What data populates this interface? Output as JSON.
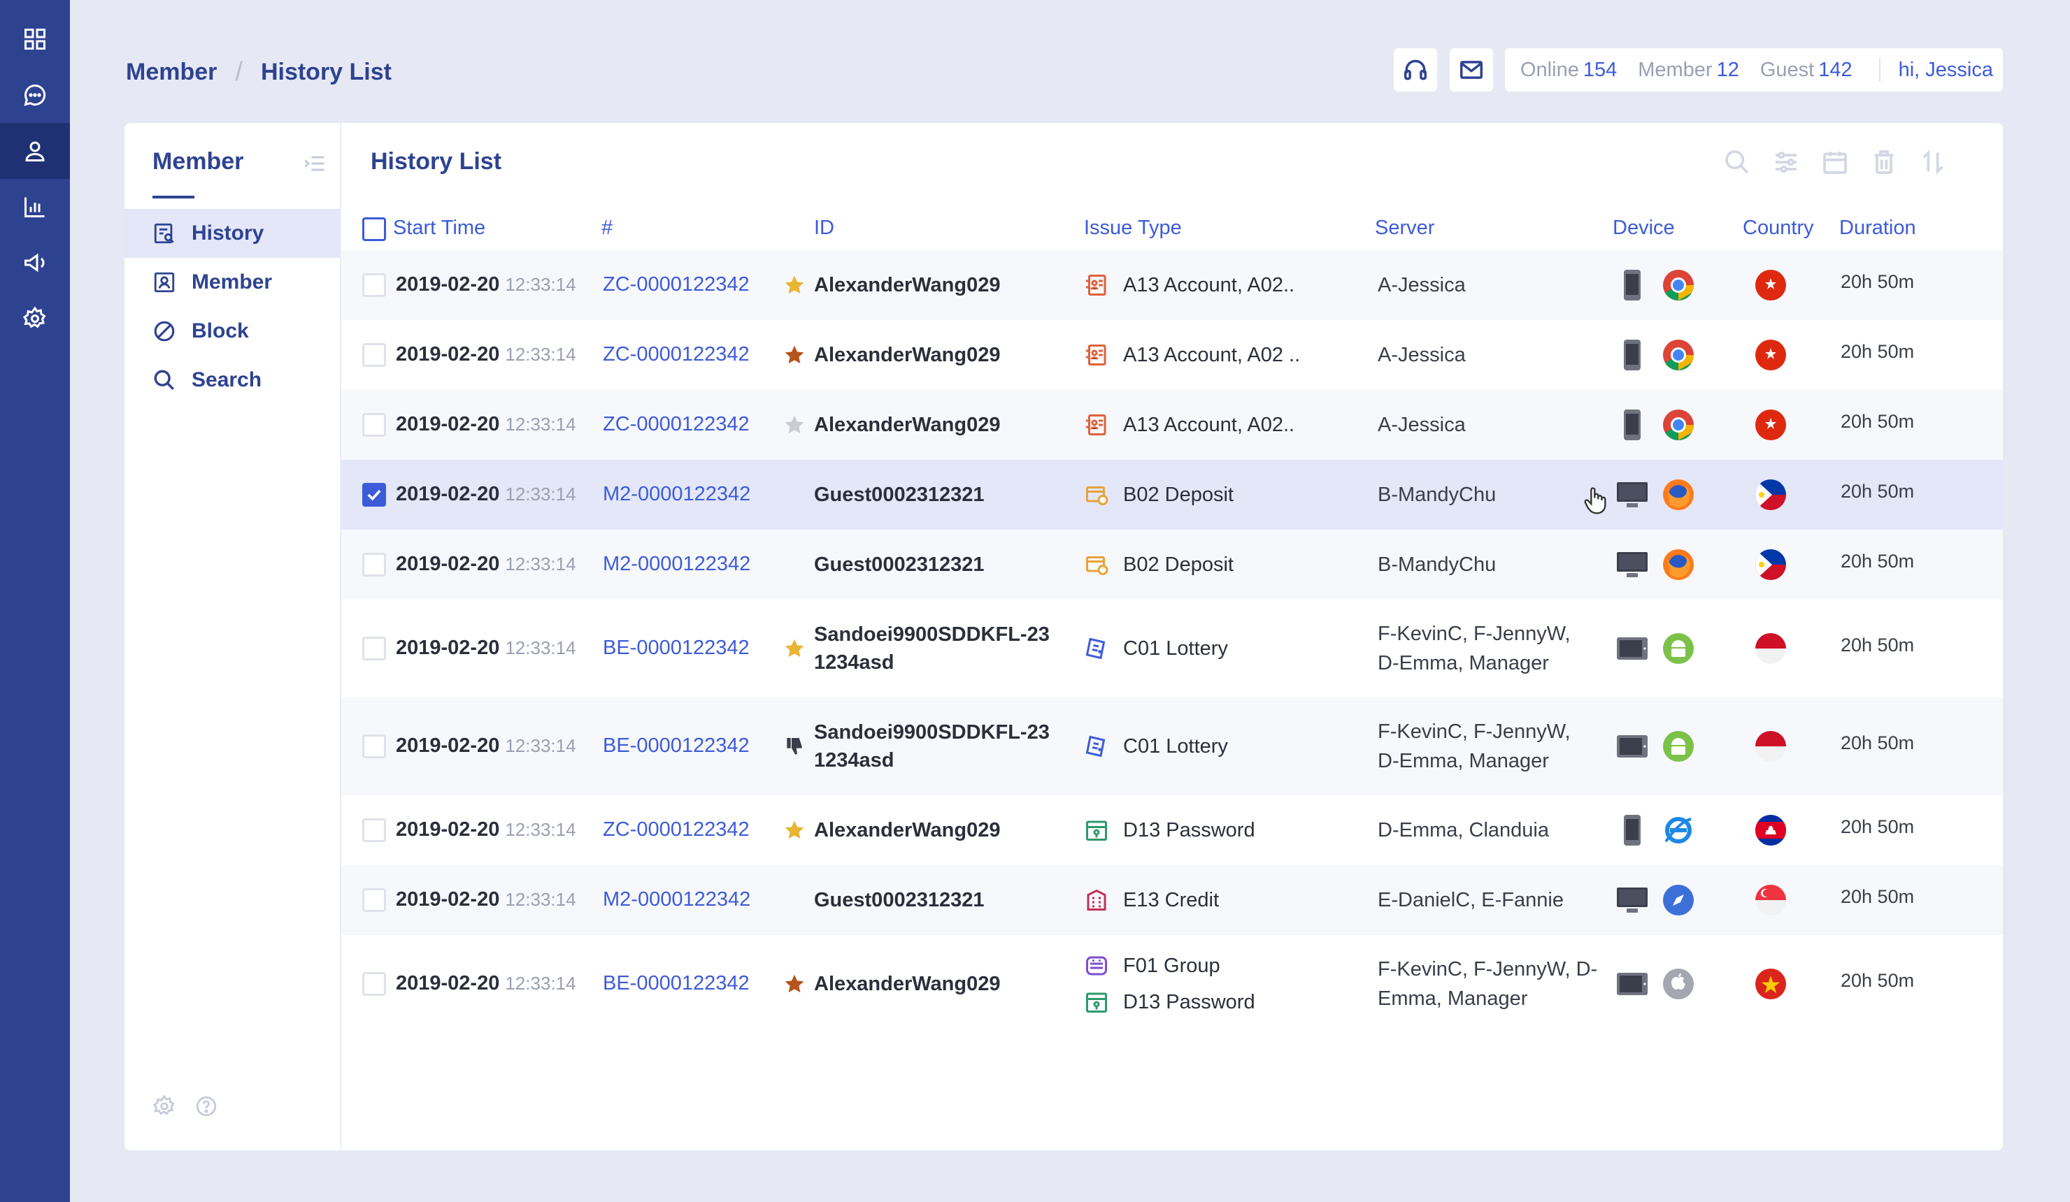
{
  "rail": {
    "items": [
      "dashboard",
      "chat",
      "member",
      "report",
      "announcement",
      "settings"
    ],
    "active": "member"
  },
  "breadcrumb": {
    "root": "Member",
    "separator": "/",
    "current": "History List"
  },
  "stats": {
    "online_label": "Online",
    "online_value": "154",
    "member_label": "Member",
    "member_value": "12",
    "guest_label": "Guest",
    "guest_value": "142",
    "greeting": "hi, Jessica"
  },
  "subnav": {
    "title": "Member",
    "items": [
      {
        "label": "History",
        "icon": "history-icon",
        "active": true
      },
      {
        "label": "Member",
        "icon": "member-card-icon",
        "active": false
      },
      {
        "label": "Block",
        "icon": "block-icon",
        "active": false
      },
      {
        "label": "Search",
        "icon": "search-icon",
        "active": false
      }
    ]
  },
  "list": {
    "title": "History List",
    "columns": [
      "Start Time",
      "#",
      "ID",
      "Issue Type",
      "Server",
      "Device",
      "Country",
      "Duration"
    ]
  },
  "rows": [
    {
      "date": "2019-02-20",
      "time": "12:33:14",
      "ticket": "ZC-0000122342",
      "mark": "star-gold",
      "id": "AlexanderWang029",
      "issues": [
        {
          "icon": "account-icon",
          "label": "A13 Account, A02.."
        }
      ],
      "server": "A-Jessica",
      "device": "phone",
      "browser": "chrome",
      "country": "hong-kong",
      "duration": "20h 50m",
      "checked": false
    },
    {
      "date": "2019-02-20",
      "time": "12:33:14",
      "ticket": "ZC-0000122342",
      "mark": "star-bronze",
      "id": "AlexanderWang029",
      "issues": [
        {
          "icon": "account-icon",
          "label": "A13 Account, A02 .."
        }
      ],
      "server": "A-Jessica",
      "device": "phone",
      "browser": "chrome",
      "country": "hong-kong",
      "duration": "20h 50m",
      "checked": false
    },
    {
      "date": "2019-02-20",
      "time": "12:33:14",
      "ticket": "ZC-0000122342",
      "mark": "star-grey",
      "id": "AlexanderWang029",
      "issues": [
        {
          "icon": "account-icon",
          "label": "A13 Account, A02.."
        }
      ],
      "server": "A-Jessica",
      "device": "phone",
      "browser": "chrome",
      "country": "hong-kong",
      "duration": "20h 50m",
      "checked": false
    },
    {
      "date": "2019-02-20",
      "time": "12:33:14",
      "ticket": "M2-0000122342",
      "mark": "",
      "id": "Guest0002312321",
      "issues": [
        {
          "icon": "deposit-icon",
          "label": "B02 Deposit"
        }
      ],
      "server": "B-MandyChu",
      "device": "desktop",
      "browser": "firefox",
      "country": "philippines",
      "duration": "20h 50m",
      "checked": true
    },
    {
      "date": "2019-02-20",
      "time": "12:33:14",
      "ticket": "M2-0000122342",
      "mark": "",
      "id": "Guest0002312321",
      "issues": [
        {
          "icon": "deposit-icon",
          "label": "B02 Deposit"
        }
      ],
      "server": "B-MandyChu",
      "device": "desktop",
      "browser": "firefox",
      "country": "philippines",
      "duration": "20h 50m",
      "checked": false
    },
    {
      "date": "2019-02-20",
      "time": "12:33:14",
      "ticket": "BE-0000122342",
      "mark": "star-gold",
      "id_lines": [
        "Sandoei9900SDDKFL-23",
        "1234asd"
      ],
      "issues": [
        {
          "icon": "lottery-icon",
          "label": "C01 Lottery"
        }
      ],
      "server_lines": [
        "F-KevinC, F-JennyW,",
        "D-Emma, Manager"
      ],
      "device": "tablet",
      "browser": "android",
      "country": "indonesia",
      "duration": "20h 50m",
      "checked": false
    },
    {
      "date": "2019-02-20",
      "time": "12:33:14",
      "ticket": "BE-0000122342",
      "mark": "thumb-down",
      "id_lines": [
        "Sandoei9900SDDKFL-23",
        "1234asd"
      ],
      "issues": [
        {
          "icon": "lottery-icon",
          "label": "C01 Lottery"
        }
      ],
      "server_lines": [
        "F-KevinC, F-JennyW,",
        "D-Emma, Manager"
      ],
      "device": "tablet",
      "browser": "android",
      "country": "indonesia",
      "duration": "20h 50m",
      "checked": false
    },
    {
      "date": "2019-02-20",
      "time": "12:33:14",
      "ticket": "ZC-0000122342",
      "mark": "star-gold",
      "id": "AlexanderWang029",
      "issues": [
        {
          "icon": "password-icon",
          "label": "D13 Password"
        }
      ],
      "server": "D-Emma, Clanduia",
      "device": "phone",
      "browser": "ie",
      "country": "cambodia",
      "duration": "20h 50m",
      "checked": false
    },
    {
      "date": "2019-02-20",
      "time": "12:33:14",
      "ticket": "M2-0000122342",
      "mark": "",
      "id": "Guest0002312321",
      "issues": [
        {
          "icon": "credit-icon",
          "label": "E13 Credit"
        }
      ],
      "server": "E-DanielC, E-Fannie",
      "device": "desktop",
      "browser": "safari",
      "country": "singapore",
      "duration": "20h 50m",
      "checked": false
    },
    {
      "date": "2019-02-20",
      "time": "12:33:14",
      "ticket": "BE-0000122342",
      "mark": "star-bronze",
      "id": "AlexanderWang029",
      "issues": [
        {
          "icon": "group-icon",
          "label": "F01 Group"
        },
        {
          "icon": "password-icon",
          "label": "D13 Password"
        }
      ],
      "server_lines": [
        "F-KevinC, F-JennyW, D-",
        "Emma, Manager"
      ],
      "device": "tablet",
      "browser": "apple",
      "country": "vietnam",
      "duration": "20h 50m",
      "checked": false
    }
  ],
  "colors": {
    "rail": "#2e4390",
    "accent": "#3d5bd8",
    "selected_row": "#e3e7f8",
    "background": "#e6e9f3"
  }
}
